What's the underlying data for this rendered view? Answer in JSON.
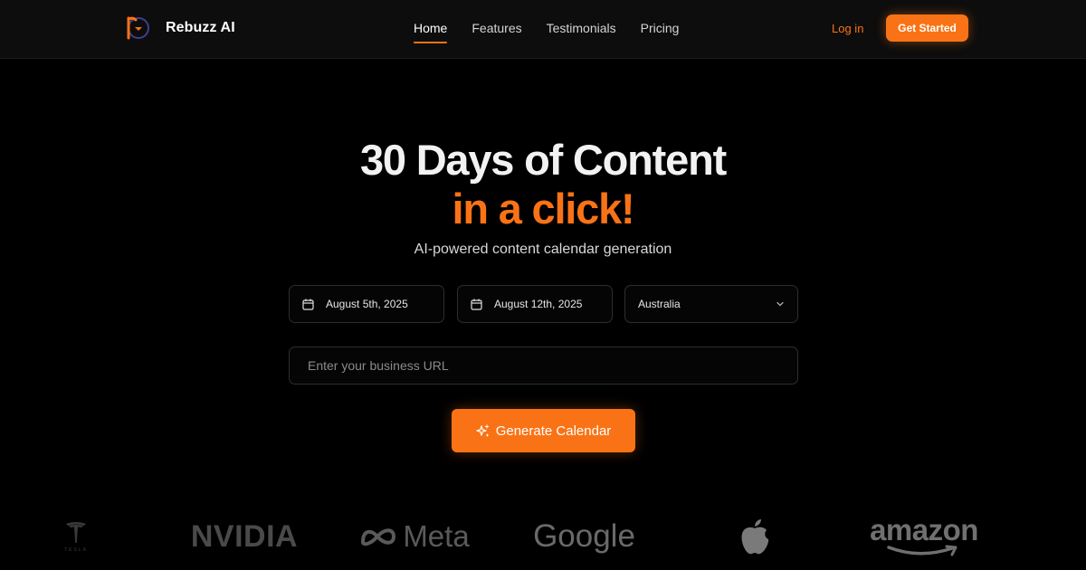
{
  "brand": {
    "name": "Rebuzz AI",
    "accent": "#f97316"
  },
  "nav": {
    "links": [
      {
        "label": "Home",
        "active": true
      },
      {
        "label": "Features",
        "active": false
      },
      {
        "label": "Testimonials",
        "active": false
      },
      {
        "label": "Pricing",
        "active": false
      }
    ],
    "login_label": "Log in",
    "cta_label": "Get Started"
  },
  "hero": {
    "title_line1": "30 Days of Content",
    "title_line2": "in a click!",
    "subtitle": "AI-powered content calendar generation"
  },
  "form": {
    "start_date": "August 5th, 2025",
    "end_date": "August 12th, 2025",
    "country": "Australia",
    "url_placeholder": "Enter your business URL",
    "url_value": "",
    "generate_label": "Generate Calendar"
  },
  "logos": {
    "tesla": "TESLA",
    "nvidia": "NVIDIA",
    "meta": "Meta",
    "google": "Google",
    "apple": "apple-logo-icon",
    "amazon": "amazon"
  }
}
